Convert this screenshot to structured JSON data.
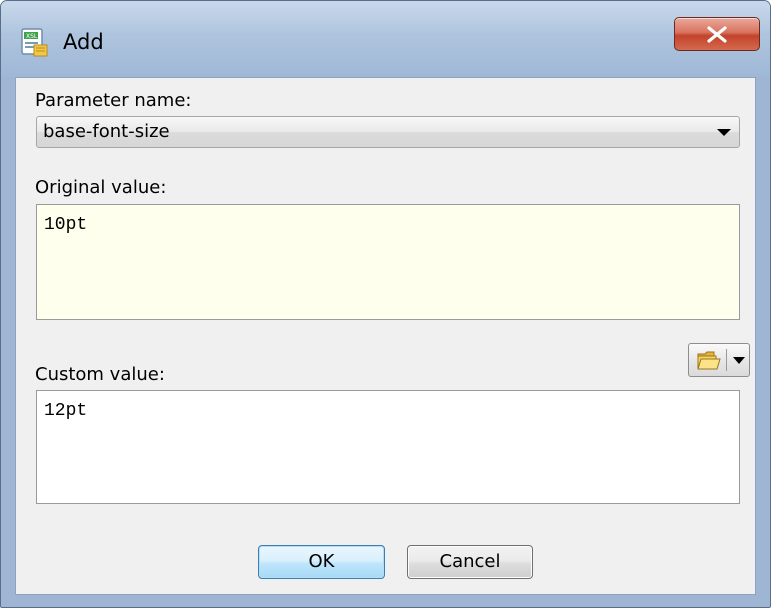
{
  "window": {
    "title": "Add",
    "icon": "xml-parameter-icon",
    "close_icon": "close-icon"
  },
  "parameter": {
    "label": "Parameter name:",
    "value": "base-font-size"
  },
  "original": {
    "label": "Original value:",
    "value": "10pt",
    "background": "#ffffee"
  },
  "custom": {
    "label": "Custom value:",
    "value": "12pt",
    "browse_icon": "folder-icon"
  },
  "buttons": {
    "ok": "OK",
    "cancel": "Cancel"
  },
  "colors": {
    "close_button": "#c2432b",
    "ok_button_border": "#3c7fb1"
  }
}
